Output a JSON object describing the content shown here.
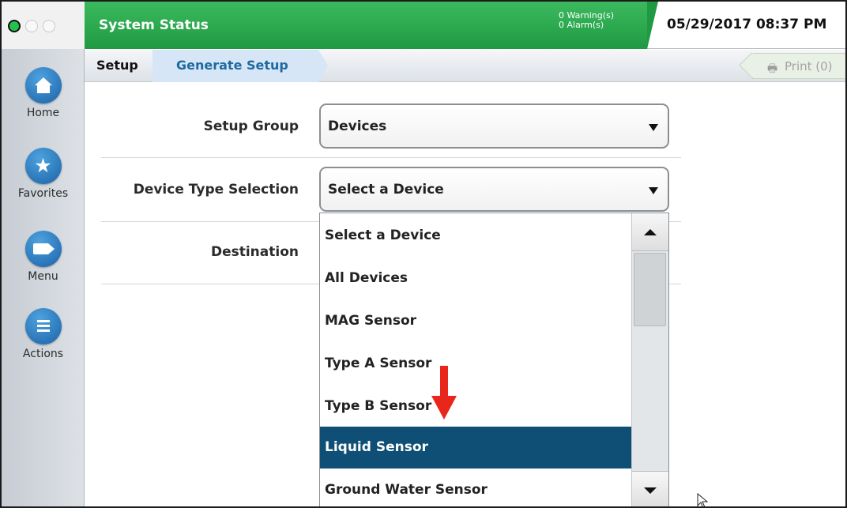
{
  "header": {
    "title": "System Status",
    "warnings": "0 Warning(s)",
    "alarms": "0 Alarm(s)",
    "datetime": "05/29/2017 08:37 PM",
    "status_color": "#2aa84e"
  },
  "sidebar": {
    "items": [
      {
        "label": "Home",
        "icon": "home-icon"
      },
      {
        "label": "Favorites",
        "icon": "star-icon"
      },
      {
        "label": "Menu",
        "icon": "menu-icon"
      },
      {
        "label": "Actions",
        "icon": "actions-icon"
      }
    ]
  },
  "breadcrumb": {
    "root": "Setup",
    "current": "Generate Setup",
    "print_label": "Print (0)"
  },
  "form": {
    "setup_group": {
      "label": "Setup Group",
      "value": "Devices"
    },
    "device_type": {
      "label": "Device Type Selection",
      "value": "Select a Device"
    },
    "destination": {
      "label": "Destination"
    }
  },
  "dropdown": {
    "options": [
      "Select a Device",
      "All Devices",
      "MAG Sensor",
      "Type A Sensor",
      "Type B Sensor",
      "Liquid Sensor",
      "Ground Water Sensor"
    ],
    "selected": "Liquid Sensor",
    "highlight_color": "#0f4e75"
  },
  "annotation": {
    "arrow_color": "#e8261c"
  }
}
